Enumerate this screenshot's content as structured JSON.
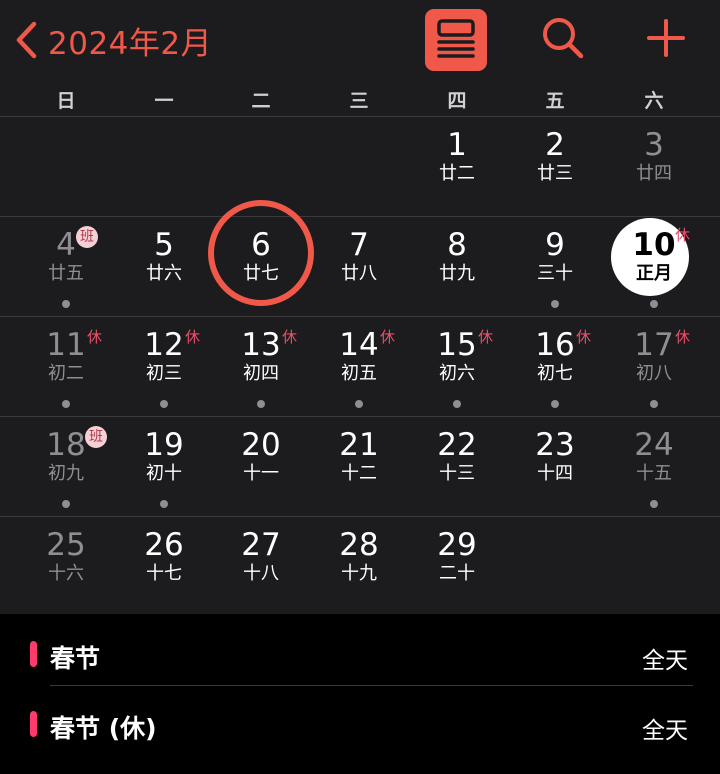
{
  "header": {
    "title": "2024年2月",
    "icons": {
      "back": "chevron-left-icon",
      "list": "list-view-icon",
      "search": "search-icon",
      "add": "plus-icon"
    }
  },
  "colors": {
    "accent": "#f0594a",
    "holiday_badge": "#e8506a",
    "event_bar": "#ff3b6b"
  },
  "weekdays": [
    "日",
    "一",
    "二",
    "三",
    "四",
    "五",
    "六"
  ],
  "weeks": [
    [
      null,
      null,
      null,
      null,
      {
        "day": "1",
        "lunar": "廿二"
      },
      {
        "day": "2",
        "lunar": "廿三"
      },
      {
        "day": "3",
        "lunar": "廿四",
        "dim": true
      }
    ],
    [
      {
        "day": "4",
        "lunar": "廿五",
        "dim": true,
        "badge": "班",
        "dot": true
      },
      {
        "day": "5",
        "lunar": "廿六"
      },
      {
        "day": "6",
        "lunar": "廿七",
        "selected": true
      },
      {
        "day": "7",
        "lunar": "廿八"
      },
      {
        "day": "8",
        "lunar": "廿九"
      },
      {
        "day": "9",
        "lunar": "三十",
        "dot": true
      },
      {
        "day": "10",
        "lunar": "正月",
        "today": true,
        "badge": "休",
        "dot": true
      }
    ],
    [
      {
        "day": "11",
        "lunar": "初二",
        "dim": true,
        "badge": "休",
        "dot": true
      },
      {
        "day": "12",
        "lunar": "初三",
        "badge": "休",
        "dot": true
      },
      {
        "day": "13",
        "lunar": "初四",
        "badge": "休",
        "dot": true
      },
      {
        "day": "14",
        "lunar": "初五",
        "badge": "休",
        "dot": true
      },
      {
        "day": "15",
        "lunar": "初六",
        "badge": "休",
        "dot": true
      },
      {
        "day": "16",
        "lunar": "初七",
        "badge": "休",
        "dot": true
      },
      {
        "day": "17",
        "lunar": "初八",
        "dim": true,
        "badge": "休",
        "dot": true
      }
    ],
    [
      {
        "day": "18",
        "lunar": "初九",
        "dim": true,
        "badge": "班",
        "dot": true
      },
      {
        "day": "19",
        "lunar": "初十",
        "dot": true
      },
      {
        "day": "20",
        "lunar": "十一"
      },
      {
        "day": "21",
        "lunar": "十二"
      },
      {
        "day": "22",
        "lunar": "十三"
      },
      {
        "day": "23",
        "lunar": "十四"
      },
      {
        "day": "24",
        "lunar": "十五",
        "dim": true,
        "dot": true
      }
    ],
    [
      {
        "day": "25",
        "lunar": "十六",
        "dim": true
      },
      {
        "day": "26",
        "lunar": "十七"
      },
      {
        "day": "27",
        "lunar": "十八"
      },
      {
        "day": "28",
        "lunar": "十九"
      },
      {
        "day": "29",
        "lunar": "二十"
      },
      null,
      null
    ]
  ],
  "events": [
    {
      "title": "春节",
      "time": "全天"
    },
    {
      "title": "春节 (休)",
      "time": "全天"
    }
  ]
}
